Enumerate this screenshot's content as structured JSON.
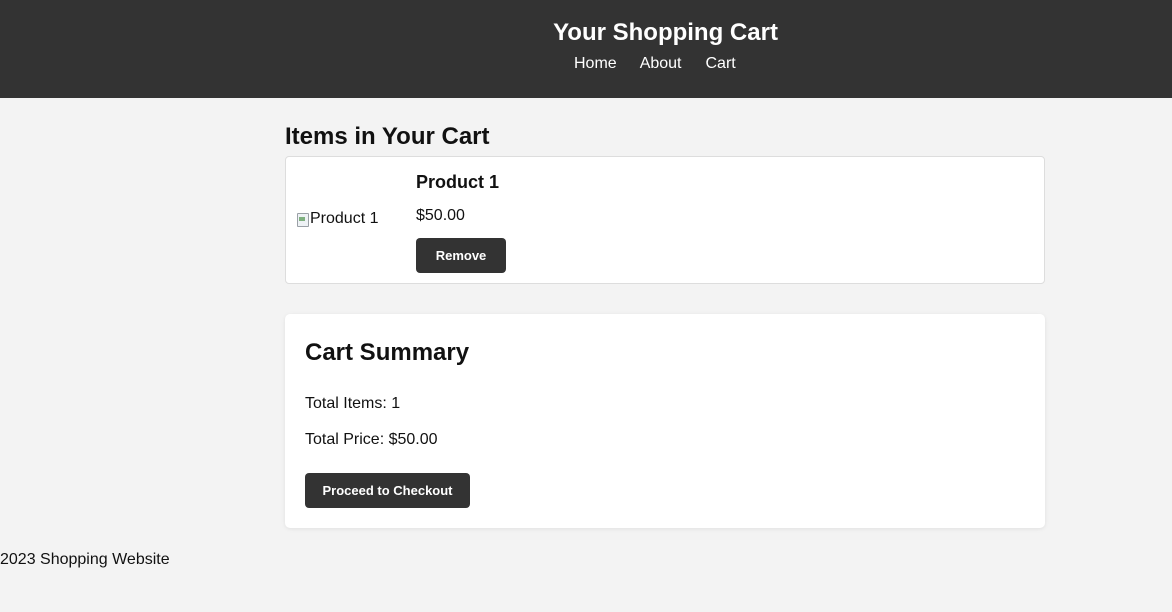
{
  "header": {
    "title": "Your Shopping Cart",
    "nav": [
      "Home",
      "About",
      "Cart"
    ]
  },
  "cart": {
    "heading": "Items in Your Cart",
    "items": [
      {
        "image_alt": "Product 1",
        "name": "Product 1",
        "price": "$50.00",
        "remove_label": "Remove"
      }
    ]
  },
  "summary": {
    "title": "Cart Summary",
    "total_items": "Total Items: 1",
    "total_price": "Total Price: $50.00",
    "checkout_label": "Proceed to Checkout"
  },
  "footer": {
    "text": "2023 Shopping Website"
  },
  "colors": {
    "header_bg": "#333333",
    "page_bg": "#f3f3f3",
    "button_bg": "#333333"
  }
}
